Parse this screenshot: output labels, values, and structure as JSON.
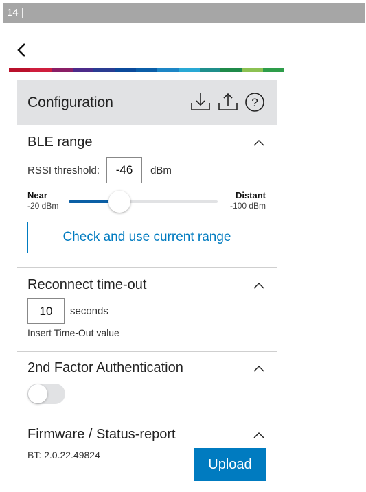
{
  "header": {
    "page_number": "14 |"
  },
  "nav": {
    "back_icon": "chevron-left-icon"
  },
  "brand_stripe_colors": [
    "#b9102b",
    "#cf1e3d",
    "#8a1e66",
    "#4c2b8a",
    "#2a3c92",
    "#0b4a9b",
    "#0b5ea8",
    "#1d86c6",
    "#29a9d5",
    "#1f8f8c",
    "#1f8a4a",
    "#8cc152",
    "#2e9d4a"
  ],
  "config": {
    "title": "Configuration",
    "icons": [
      "download-icon",
      "upload-icon",
      "help-icon"
    ]
  },
  "ble": {
    "title": "BLE range",
    "rssi_label": "RSSI threshold:",
    "rssi_value": "-46",
    "rssi_unit": "dBm",
    "near_label": "Near",
    "near_value": "-20 dBm",
    "far_label": "Distant",
    "far_value": "-100 dBm",
    "slider_fraction": 0.34,
    "check_button": "Check and use current range"
  },
  "reconnect": {
    "title": "Reconnect time-out",
    "value": "10",
    "unit": "seconds",
    "hint": "Insert Time-Out value"
  },
  "twofa": {
    "title": "2nd Factor Authentication",
    "enabled": false
  },
  "firmware": {
    "title": "Firmware / Status-report",
    "bt_version": "BT: 2.0.22.49824",
    "upload_button": "Upload"
  },
  "colors": {
    "accent": "#007bc0",
    "slider_fill": "#0b5fa5",
    "panel_bg": "#e1e2e4",
    "header_bg": "#a6a6a6"
  }
}
